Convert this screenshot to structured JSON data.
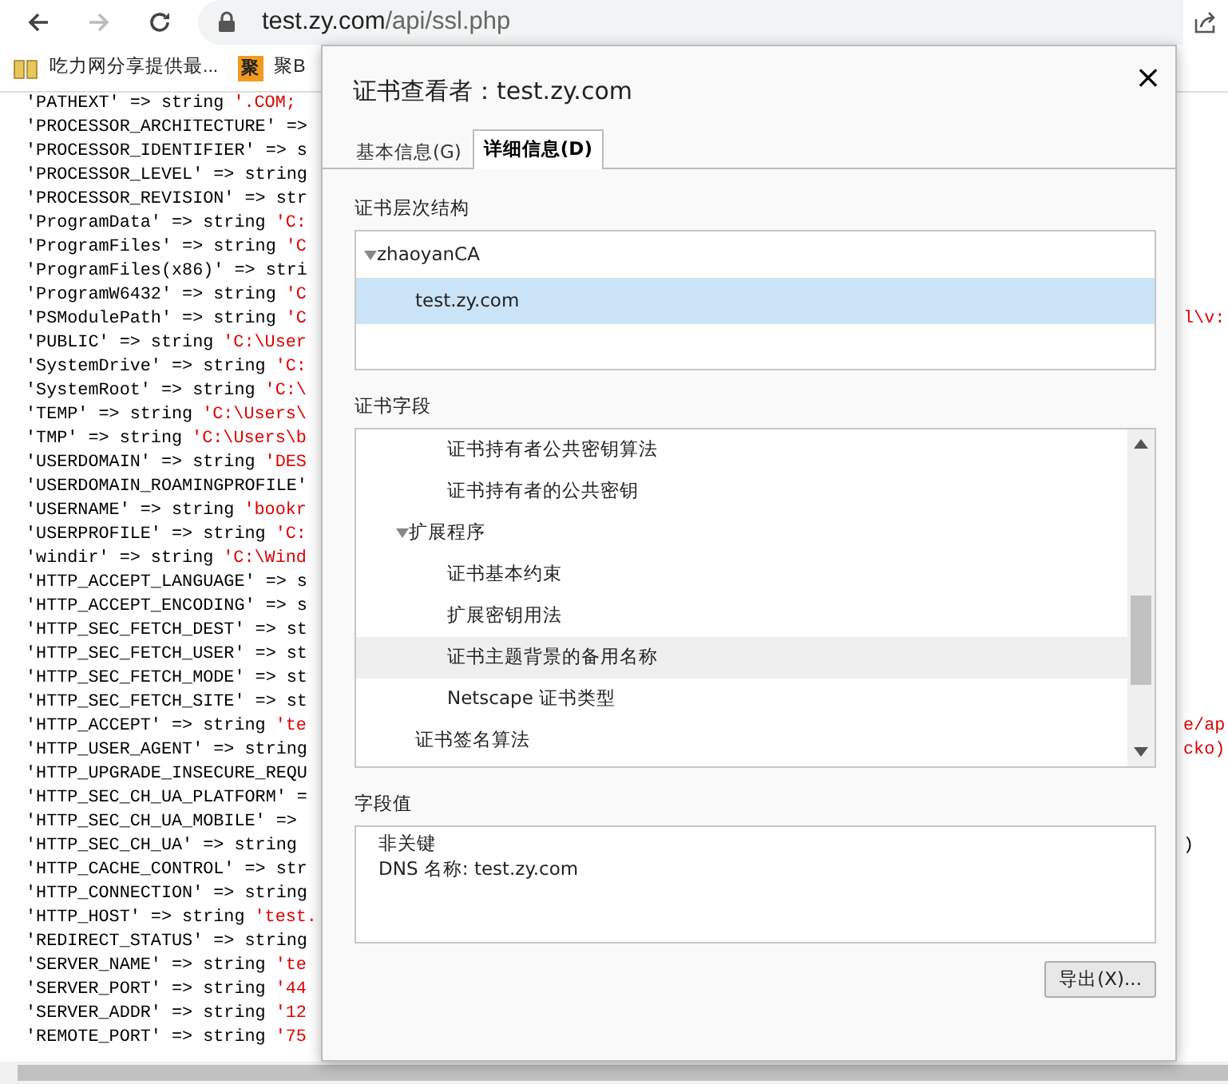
{
  "browser": {
    "nav_buttons": [
      {
        "kind": "back",
        "disabled": false
      },
      {
        "kind": "forward",
        "disabled": true
      },
      {
        "kind": "reload",
        "disabled": false
      }
    ],
    "url_host": "test.zy.com",
    "url_path": "/api/ssl.php",
    "bookmarks": [
      {
        "kind": "book",
        "label": "吃力网分享提供最..."
      },
      {
        "kind": "badge",
        "icon_char": "聚",
        "label": "聚B"
      }
    ]
  },
  "page_lines": [
    {
      "text": "'PATHEXT' => string",
      "value": "'.COM;"
    },
    {
      "text": "'PROCESSOR_ARCHITECTURE' =>"
    },
    {
      "text": "'PROCESSOR_IDENTIFIER' => s"
    },
    {
      "text": "'PROCESSOR_LEVEL' => string"
    },
    {
      "text": "'PROCESSOR_REVISION' => str"
    },
    {
      "text": "'ProgramData' => string",
      "value": "'C:"
    },
    {
      "text": "'ProgramFiles' => string",
      "value": "'C"
    },
    {
      "text": "'ProgramFiles(x86)' => stri"
    },
    {
      "text": "'ProgramW6432' => string",
      "value": "'C"
    },
    {
      "text": "'PSModulePath' => string",
      "value": "'C",
      "tail": "l\\v:",
      "tail_red": true
    },
    {
      "text": "'PUBLIC' => string",
      "value": "'C:\\User"
    },
    {
      "text": "'SystemDrive' => string",
      "value": "'C:"
    },
    {
      "text": "'SystemRoot' => string",
      "value": "'C:\\"
    },
    {
      "text": "'TEMP' => string",
      "value": "'C:\\Users\\"
    },
    {
      "text": "'TMP' => string",
      "value": "'C:\\Users\\b"
    },
    {
      "text": "'USERDOMAIN' => string",
      "value": "'DES"
    },
    {
      "text": "'USERDOMAIN_ROAMINGPROFILE'"
    },
    {
      "text": "'USERNAME' => string",
      "value": "'bookr"
    },
    {
      "text": "'USERPROFILE' => string",
      "value": "'C:"
    },
    {
      "text": "'windir' => string",
      "value": "'C:\\Wind"
    },
    {
      "text": "'HTTP_ACCEPT_LANGUAGE' => s"
    },
    {
      "text": "'HTTP_ACCEPT_ENCODING' => s"
    },
    {
      "text": "'HTTP_SEC_FETCH_DEST' => st"
    },
    {
      "text": "'HTTP_SEC_FETCH_USER' => st"
    },
    {
      "text": "'HTTP_SEC_FETCH_MODE' => st"
    },
    {
      "text": "'HTTP_SEC_FETCH_SITE' => st"
    },
    {
      "text": "'HTTP_ACCEPT' => string",
      "value": "'te",
      "tail": "e/ap",
      "tail_red": true
    },
    {
      "text": "'HTTP_USER_AGENT' => string",
      "tail": "cko)",
      "tail_red": true
    },
    {
      "text": "'HTTP_UPGRADE_INSECURE_REQU"
    },
    {
      "text": "'HTTP_SEC_CH_UA_PLATFORM' ="
    },
    {
      "text": "'HTTP_SEC_CH_UA_MOBILE' =>"
    },
    {
      "text": "'HTTP_SEC_CH_UA' => string",
      "tail": ")",
      "tail_red": false
    },
    {
      "text": "'HTTP_CACHE_CONTROL' => str"
    },
    {
      "text": "'HTTP_CONNECTION' => string"
    },
    {
      "text": "'HTTP_HOST' => string",
      "value": "'test."
    },
    {
      "text": "'REDIRECT_STATUS' => string"
    },
    {
      "text": "'SERVER_NAME' => string",
      "value": "'te"
    },
    {
      "text": "'SERVER_PORT' => string",
      "value": "'44"
    },
    {
      "text": "'SERVER_ADDR' => string",
      "value": "'12"
    },
    {
      "text": "'REMOTE_PORT' => string",
      "value": "'75"
    }
  ],
  "dialog": {
    "title": "证书查看者：test.zy.com",
    "close": "×",
    "tabs": [
      {
        "label": "基本信息(G)",
        "selected": false
      },
      {
        "label": "详细信息(D)",
        "selected": true
      }
    ],
    "hierarchy_heading": "证书层次结构",
    "hierarchy": [
      {
        "label": "zhaoyanCA",
        "expanded": true,
        "selected": false,
        "children": [
          {
            "label": "test.zy.com",
            "selected": true
          }
        ]
      }
    ],
    "fields_heading": "证书字段",
    "fields": [
      {
        "children": [
          {
            "label": "证书持有者公共密钥算法",
            "selected": false
          },
          {
            "label": "证书持有者的公共密钥",
            "selected": false
          }
        ]
      },
      {
        "label": "扩展程序",
        "expanded": true,
        "selected": false,
        "children": [
          {
            "label": "证书基本约束",
            "selected": false
          },
          {
            "label": "扩展密钥用法",
            "selected": false
          },
          {
            "label": "证书主题背景的备用名称",
            "selected": true
          },
          {
            "label": "Netscape 证书类型",
            "selected": false
          }
        ]
      },
      {
        "label": "证书签名算法",
        "selected": false
      }
    ],
    "value_heading": "字段值",
    "value_lines": [
      "非关键",
      "DNS 名称: test.zy.com"
    ],
    "export_button": "导出(X)..."
  }
}
